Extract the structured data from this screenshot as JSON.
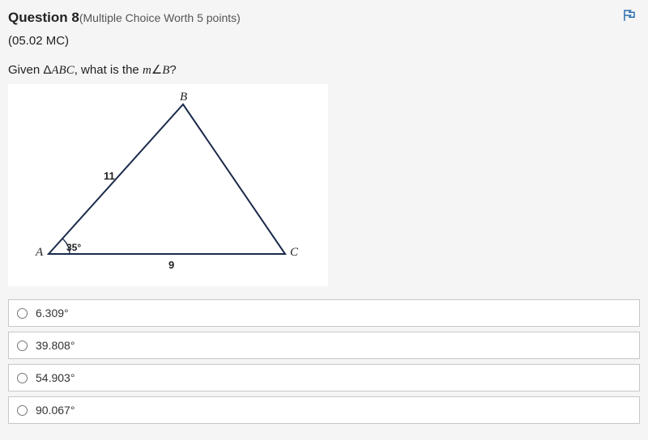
{
  "header": {
    "question_label": "Question 8",
    "worth_text": "(Multiple Choice Worth 5 points)"
  },
  "topic_code": "(05.02 MC)",
  "prompt": {
    "prefix": "Given Δ",
    "triangle": "ABC",
    "mid": ", what is the ",
    "measure_m": "m",
    "angle_sym": "∠",
    "angle_vertex": "B",
    "suffix": "?"
  },
  "diagram": {
    "vertex_A": "A",
    "vertex_B": "B",
    "vertex_C": "C",
    "side_AB": "11",
    "side_AC": "9",
    "angle_A": "35°"
  },
  "options": [
    {
      "label": "6.309°"
    },
    {
      "label": "39.808°"
    },
    {
      "label": "54.903°"
    },
    {
      "label": "90.067°"
    }
  ],
  "flag_icon": "⚑"
}
